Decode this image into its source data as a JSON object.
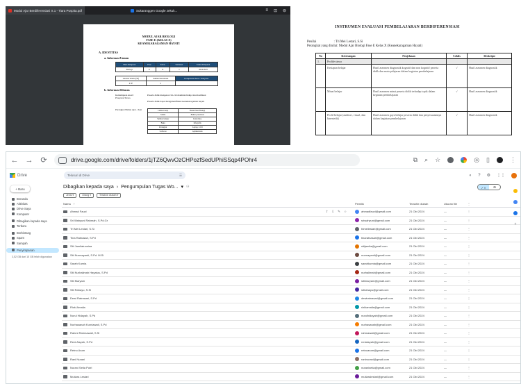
{
  "pdf_viewer": {
    "tab1_label": "Modul Ajar Berdiferensiasi X.1 - Tiara Puspita.pdf",
    "tab2_label": "Sukaranggen Google Jekuk...",
    "controls": [
      "≡",
      "⊡",
      "⊖"
    ],
    "page": {
      "title1": "MODUL AJAR BIOLOGI",
      "title2": "FASE E (KELAS X)",
      "title3": "KEANEKARAGAMAN HAYATI",
      "section_a": "A. IDENTITAS",
      "subsection_1": "a. Informasi Umum",
      "table1_headers": [
        "Mata Pelajaran",
        "Fase",
        "Kelas",
        "Semester",
        "Tahun Pelajaran"
      ],
      "table1_row": [
        "Biologi",
        "E",
        "X",
        "I",
        "2024/2025"
      ],
      "table1_row2": [
        "Alokasi Waktu (JP)",
        "Jumlah Pertemuan",
        "Kompetensi Awal / Prasyarat"
      ],
      "table1_row2_values": [
        "4 JP",
        "2"
      ],
      "section_b": "b. Informasi Khusus",
      "label_1": "Kemampuan Awal / Prasyarat Siswa",
      "label_2": "Perangkat Bahan Ajar / Alat",
      "bullet_1": "Peserta didik mengenal ciri-ciri makhluk hidup dan klasifikasi",
      "bullet_2": "Peserta didik dapat mengidentifikasi keanekaragaman hayati",
      "bullets": [
        "Lembar kerja",
        "Media",
        "Sumber belajar",
        "Buku",
        "Perangkat",
        "Software"
      ],
      "bullet_values": [
        "Buku Paket Biologi",
        "Bahan presentasi",
        "Link video",
        "Infografis",
        "Laptop, LCD",
        "Aplikasi kuis"
      ]
    }
  },
  "eval_doc": {
    "title": "INSTRUMEN EVALUASI PEMBELAJARAN BERDIFERENSIASI",
    "meta_1_label": "Penilai",
    "meta_1_value": ": Tri Mei Lestari, S.Si",
    "meta_2": "Perangkat yang dinilai: Modul Ajar Biologi Fase E Kelas X (Keanekaragaman Hayati)",
    "headers": [
      "No",
      "Keterangan",
      "Penjelasan",
      "Ceklis",
      "Deskripsi"
    ],
    "rows": [
      {
        "no": "1.",
        "ket": "Profile siswa",
        "pen": "",
        "cek": "",
        "desk": "",
        "section": true
      },
      {
        "no": "",
        "ket": "Kesiapan belajar",
        "pen": "Hasil asesmen diagnostik kognitif dan non kognitif peserta didik dan mata pelajaran dalam kegiatan pembelajaran",
        "cek": "√",
        "desk": "Hasil asesmen diagnostik",
        "section": false
      },
      {
        "no": "",
        "ket": "Minat belajar",
        "pen": "Hasil asesmen minat peserta didik terhadap topik dalam kegiatan pembelajaran",
        "cek": "√",
        "desk": "Hasil asesmen diagnostik",
        "section": false
      },
      {
        "no": "",
        "ket": "Profil belajar (auditori, visual, dan kinestetik)",
        "pen": "Hasil asesmen gaya belajar peserta didik dan penyesuaiannya dalam kegiatan pembelajaran",
        "cek": "√",
        "desk": "Hasil asesmen diagnostik",
        "section": false
      }
    ]
  },
  "browser": {
    "url": "drive.google.com/drive/folders/1jTZ6QwvOzCHPozfSedUPhiSSqp4POhr4",
    "nav": [
      "←",
      "→",
      "⟳"
    ]
  },
  "drive": {
    "app_name": "Drive",
    "search_placeholder": "Telusuri di Drive",
    "new_label": "+ Baru",
    "sidebar": [
      {
        "label": "Beranda",
        "active": false
      },
      {
        "label": "Aktivitas",
        "active": false
      },
      {
        "label": "Drive Saya",
        "active": false
      },
      {
        "label": "Komputer",
        "active": false
      },
      {
        "label": "Dibagikan kepada saya",
        "active": false
      },
      {
        "label": "Terbaru",
        "active": false
      },
      {
        "label": "Berbintang",
        "active": false
      },
      {
        "label": "Spam",
        "active": false
      },
      {
        "label": "Sampah",
        "active": false
      },
      {
        "label": "Penyimpanan",
        "active": true
      }
    ],
    "storage_text": "3,52 GB dari 15 GB telah digunakan",
    "breadcrumb_root": "Dibagikan kepada saya",
    "breadcrumb_sep": "›",
    "breadcrumb_folder": "Pengumpulan Tugas Wo...",
    "breadcrumb_caret": "▾",
    "filters": [
      "Jenis ▾",
      "Orang ▾",
      "Terakhir diubah ▾"
    ],
    "columns": {
      "name": "Nama",
      "owner": "Pemilik",
      "modified": "Terakhir diubah",
      "size": "Ukuran file"
    },
    "rows": [
      {
        "name": "Ahmad Fauzi",
        "owner": "ahmadfauzi@gmail.com",
        "modified": "21 Okt 2024",
        "avatar": "#4285f4"
      },
      {
        "name": "Sri Wahyuni Rahmah, S.Pd.Gr",
        "owner": "sriwahyuni@gmail.com",
        "modified": "21 Okt 2024",
        "avatar": "#8e24aa"
      },
      {
        "name": "Tri Mei Lestari, S.Si",
        "owner": "trimeilestari@gmail.com",
        "modified": "21 Okt 2024",
        "avatar": "#5f6368"
      },
      {
        "name": "Tina Ratnasari, S.Pd",
        "owner": "tinaratnasari@gmail.com",
        "modified": "21 Okt 2024",
        "avatar": "#1a73e8"
      },
      {
        "name": "Siti Jamilatunnisa",
        "owner": "sitijamila@gmail.com",
        "modified": "21 Okt 2024",
        "avatar": "#e37400"
      },
      {
        "name": "Siti Nurmayanti, S.Pd. M.Si",
        "owner": "nurmayanti@gmail.com",
        "modified": "21 Okt 2024",
        "avatar": "#6d4c41"
      },
      {
        "name": "Sarah Kurnia",
        "owner": "sarahkurnia@gmail.com",
        "modified": "21 Okt 2024",
        "avatar": "#3c4043"
      },
      {
        "name": "Siti Nurhalimah Hayatus, S.Pd",
        "owner": "nurhalimah@gmail.com",
        "modified": "21 Okt 2024",
        "avatar": "#a52714"
      },
      {
        "name": "Siti Maryam",
        "owner": "sitimaryam@gmail.com",
        "modified": "21 Okt 2024",
        "avatar": "#7b1fa2"
      },
      {
        "name": "Siti Rahayu, S.Si",
        "owner": "sitirahayu@gmail.com",
        "modified": "21 Okt 2024",
        "avatar": "#4527a0"
      },
      {
        "name": "Dewi Ratnasari, S.Pd",
        "owner": "dewiratnasari@gmail.com",
        "modified": "21 Okt 2024",
        "avatar": "#1e88e5"
      },
      {
        "name": "Rizki Amalia",
        "owner": "rizkiamalia@gmail.com",
        "modified": "21 Okt 2024",
        "avatar": "#0097a7"
      },
      {
        "name": "Nurul Hidayah, S.Pd",
        "owner": "nurulhidayah@gmail.com",
        "modified": "21 Okt 2024",
        "avatar": "#546e7a"
      },
      {
        "name": "Nurhasanah Kurniawati, S.Pd",
        "owner": "nurhasanah@gmail.com",
        "modified": "21 Okt 2024",
        "avatar": "#f57c00"
      },
      {
        "name": "Rahmi Rahmawati, S.Si",
        "owner": "rahmawati@gmail.com",
        "modified": "21 Okt 2024",
        "avatar": "#c2185b"
      },
      {
        "name": "Reni Aisyah, S.Pd",
        "owner": "reniaisyah@gmail.com",
        "modified": "21 Okt 2024",
        "avatar": "#1565c0"
      },
      {
        "name": "Retno Arum",
        "owner": "retnoarum@gmail.com",
        "modified": "21 Okt 2024",
        "avatar": "#1a73e8"
      },
      {
        "name": "Rani Nurani",
        "owner": "raninurani@gmail.com",
        "modified": "21 Okt 2024",
        "avatar": "#8d6e63"
      },
      {
        "name": "Nurani Setia Putri",
        "owner": "nuranisetia@gmail.com",
        "modified": "21 Okt 2024",
        "avatar": "#43a047"
      },
      {
        "name": "Mutiara Lestari",
        "owner": "mutiaralestari@gmail.com",
        "modified": "21 Okt 2024",
        "avatar": "#6a1b9a"
      },
      {
        "name": "Maulidya",
        "owner": "maulidya@gmail.com",
        "modified": "21 Okt 2024",
        "avatar": "#00838f"
      },
      {
        "name": "Nurul Hikmah, S.Pd",
        "owner": "nurulhikmah@gmail.com",
        "modified": "21 Okt 2024",
        "avatar": "#4285f4"
      }
    ]
  }
}
